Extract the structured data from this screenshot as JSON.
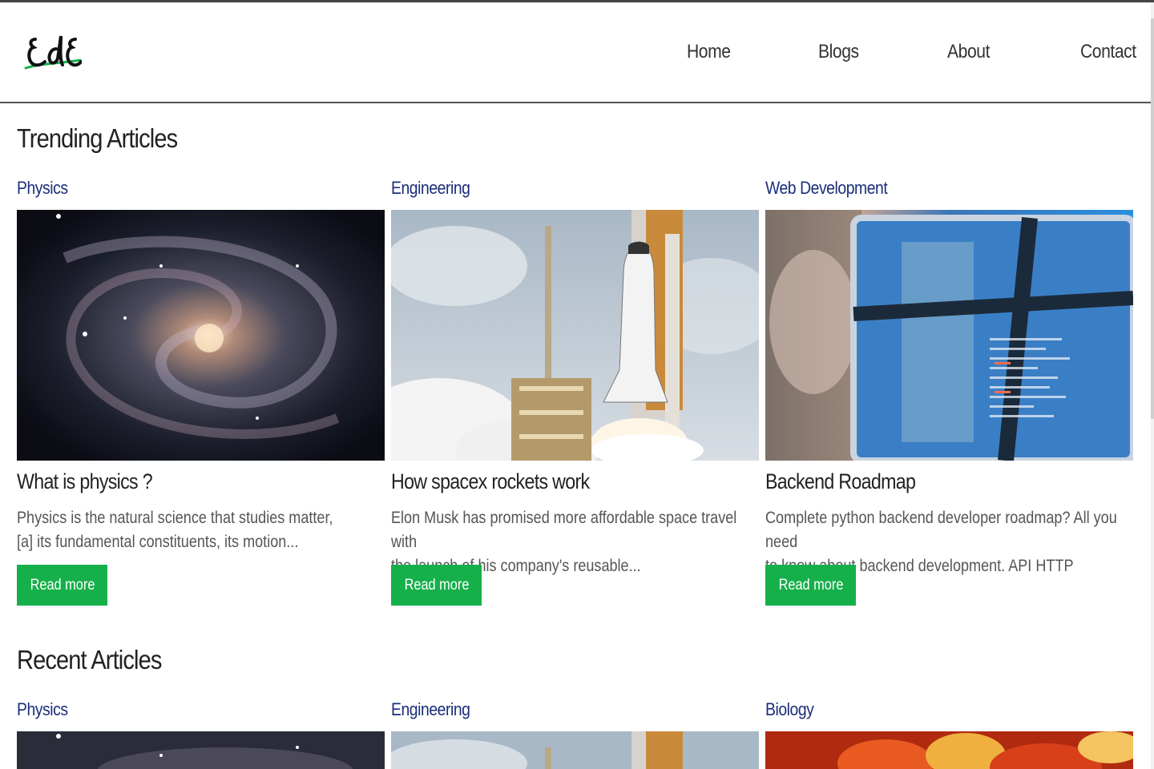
{
  "nav": {
    "logo_text": "EdE",
    "links": [
      "Home",
      "Blogs",
      "About",
      "Contact"
    ]
  },
  "trending": {
    "title": "Trending Articles",
    "cards": [
      {
        "category": "Physics",
        "image_icon": "galaxy-image",
        "title": "What is physics ?",
        "excerpt_line1": "Physics is the natural science that studies matter,",
        "excerpt_line2": "[a] its fundamental constituents, its motion...",
        "button": "Read more"
      },
      {
        "category": "Engineering",
        "image_icon": "space-shuttle-image",
        "title": "How spacex rockets work",
        "excerpt_line1": "Elon Musk has promised more affordable space travel with",
        "excerpt_line2": "the launch of his company's reusable...",
        "button": "Read more"
      },
      {
        "category": "Web Development",
        "image_icon": "laptop-code-image",
        "title": "Backend Roadmap",
        "excerpt_line1": "Complete python backend developer roadmap? All you need",
        "excerpt_line2": "to know about backend development. API HTTP",
        "button": "Read more"
      }
    ]
  },
  "recent": {
    "title": "Recent Articles",
    "cards": [
      {
        "category": "Physics",
        "image_icon": "galaxy-image"
      },
      {
        "category": "Engineering",
        "image_icon": "space-shuttle-image"
      },
      {
        "category": "Biology",
        "image_icon": "cells-image"
      }
    ]
  },
  "colors": {
    "accent": "#16b04b",
    "category": "#1a2d7a",
    "text": "#222222",
    "excerpt": "#555555"
  }
}
